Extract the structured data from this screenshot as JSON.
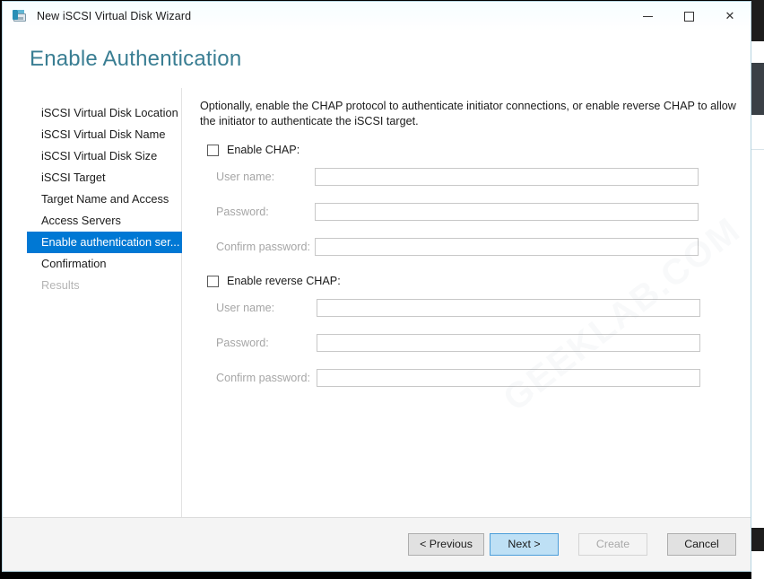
{
  "window": {
    "title": "New iSCSI Virtual Disk Wizard",
    "icon": "iscsi-disk-icon",
    "caption_buttons": {
      "minimize": "–",
      "maximize": "□",
      "close": "✕"
    }
  },
  "page": {
    "heading": "Enable Authentication",
    "heading_color": "#3a7e93",
    "intro": "Optionally, enable the CHAP protocol to authenticate initiator connections, or enable reverse CHAP to allow the initiator to authenticate the iSCSI target."
  },
  "sidebar": {
    "selected_index": 6,
    "selected_color": "#0078d4",
    "items": [
      {
        "label": "iSCSI Virtual Disk Location",
        "state": "normal"
      },
      {
        "label": "iSCSI Virtual Disk Name",
        "state": "normal"
      },
      {
        "label": "iSCSI Virtual Disk Size",
        "state": "normal"
      },
      {
        "label": "iSCSI Target",
        "state": "normal"
      },
      {
        "label": "Target Name and Access",
        "state": "normal"
      },
      {
        "label": "Access Servers",
        "state": "normal"
      },
      {
        "label": "Enable authentication ser...",
        "state": "selected"
      },
      {
        "label": "Confirmation",
        "state": "normal"
      },
      {
        "label": "Results",
        "state": "disabled"
      }
    ]
  },
  "chap": {
    "checkbox_label": "Enable CHAP:",
    "checked": false,
    "fields": [
      {
        "label": "User name:",
        "value": "",
        "placeholder": ""
      },
      {
        "label": "Password:",
        "value": "",
        "placeholder": ""
      },
      {
        "label": "Confirm password:",
        "value": "",
        "placeholder": ""
      }
    ]
  },
  "reverse_chap": {
    "checkbox_label": "Enable reverse CHAP:",
    "checked": false,
    "fields": [
      {
        "label": "User name:",
        "value": "",
        "placeholder": ""
      },
      {
        "label": "Password:",
        "value": "",
        "placeholder": ""
      },
      {
        "label": "Confirm password:",
        "value": "",
        "placeholder": ""
      }
    ]
  },
  "footer": {
    "previous_label": "< Previous",
    "next_label": "Next >",
    "create_label": "Create",
    "cancel_label": "Cancel",
    "next_highlight_color": "#bee0f5"
  },
  "watermark": {
    "text": "GEEKLAB.COM"
  }
}
